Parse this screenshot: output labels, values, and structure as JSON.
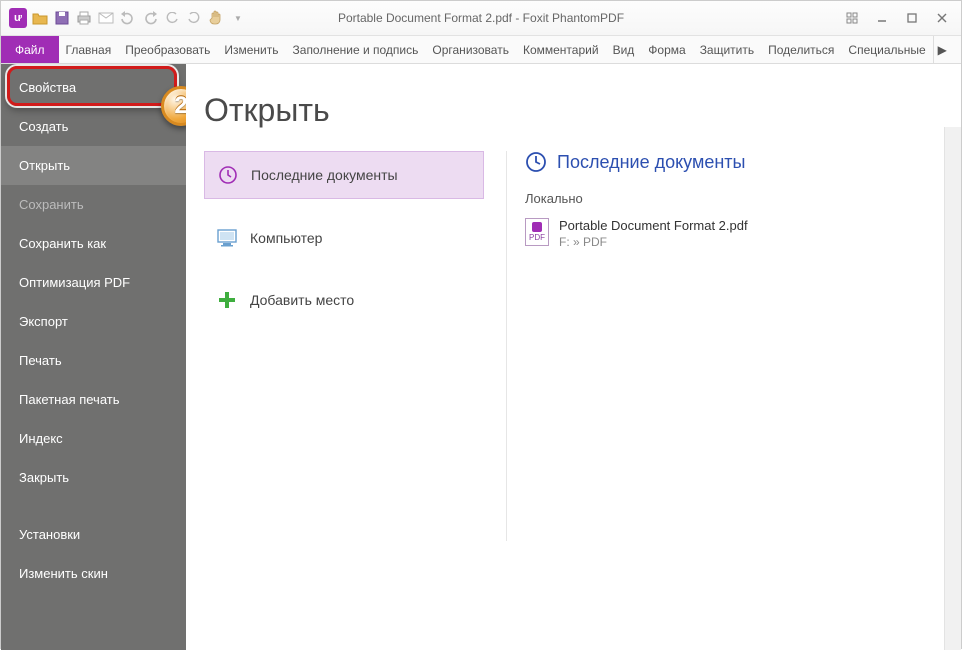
{
  "window": {
    "title": "Portable Document Format 2.pdf - Foxit PhantomPDF"
  },
  "ribbon": {
    "file": "Файл",
    "tabs": [
      "Главная",
      "Преобразовать",
      "Изменить",
      "Заполнение и подпись",
      "Организовать",
      "Комментарий",
      "Вид",
      "Форма",
      "Защитить",
      "Поделиться",
      "Специальные"
    ]
  },
  "file_menu": {
    "items": [
      {
        "label": "Свойства",
        "state": "highlighted"
      },
      {
        "label": "Создать",
        "state": "normal"
      },
      {
        "label": "Открыть",
        "state": "selected"
      },
      {
        "label": "Сохранить",
        "state": "disabled"
      },
      {
        "label": "Сохранить как",
        "state": "normal"
      },
      {
        "label": "Оптимизация PDF",
        "state": "normal"
      },
      {
        "label": "Экспорт",
        "state": "normal"
      },
      {
        "label": "Печать",
        "state": "normal"
      },
      {
        "label": "Пакетная печать",
        "state": "normal"
      },
      {
        "label": "Индекс",
        "state": "normal"
      },
      {
        "label": "Закрыть",
        "state": "normal"
      }
    ],
    "footer": [
      {
        "label": "Установки"
      },
      {
        "label": "Изменить скин"
      }
    ]
  },
  "callout": {
    "number": "2"
  },
  "open_page": {
    "heading": "Открыть",
    "sources": [
      {
        "label": "Последние документы",
        "icon": "clock",
        "selected": true
      },
      {
        "label": "Компьютер",
        "icon": "computer",
        "selected": false
      },
      {
        "label": "Добавить место",
        "icon": "plus",
        "selected": false
      }
    ],
    "recent_heading": "Последние документы",
    "groups": [
      {
        "title": "Локально",
        "files": [
          {
            "name": "Portable Document Format 2.pdf",
            "path": "F: » PDF"
          }
        ]
      }
    ]
  }
}
